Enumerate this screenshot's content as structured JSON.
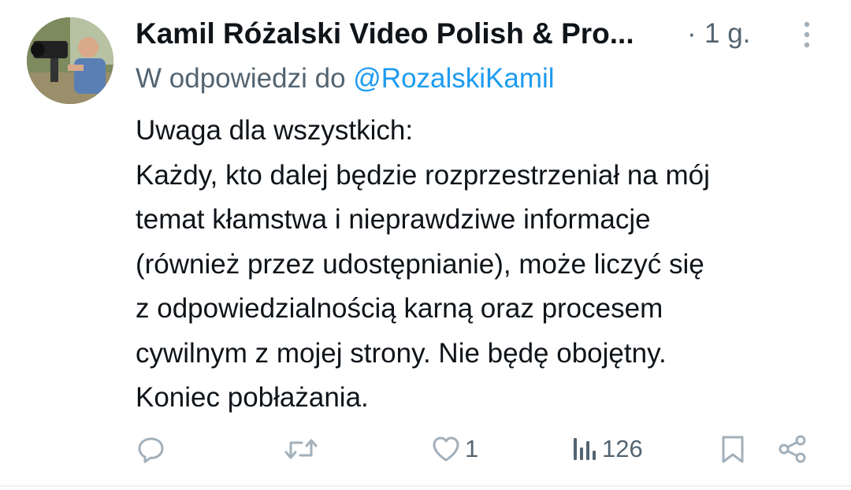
{
  "author": {
    "display_name": "Kamil Różalski Video Polish & Pro...",
    "separator": "·",
    "timestamp": "1 g."
  },
  "reply": {
    "prefix": "W odpowiedzi do ",
    "mention": "@RozalskiKamil"
  },
  "tweet": {
    "lines": [
      "Uwaga dla wszystkich:",
      "Każdy, kto dalej będzie rozprzestrzeniał na mój",
      "temat kłamstwa i nieprawdziwe informacje",
      "(również przez udostępnianie), może liczyć się",
      "z odpowiedzialnością karną oraz procesem",
      "cywilnym z mojej strony. Nie będę obojętny.",
      "Koniec pobłażania."
    ]
  },
  "actions": {
    "like_count": "1",
    "views_count": "126"
  },
  "icons": {
    "reply": "reply-icon",
    "retweet": "retweet-icon",
    "like": "heart-icon",
    "views": "views-bar-chart-icon",
    "bookmark": "bookmark-icon",
    "share": "share-icon",
    "more": "more-vertical-icon"
  },
  "colors": {
    "text": "#0f1419",
    "secondary": "#536471",
    "accent": "#1d9bf0",
    "icon": "#a2b0bb"
  }
}
